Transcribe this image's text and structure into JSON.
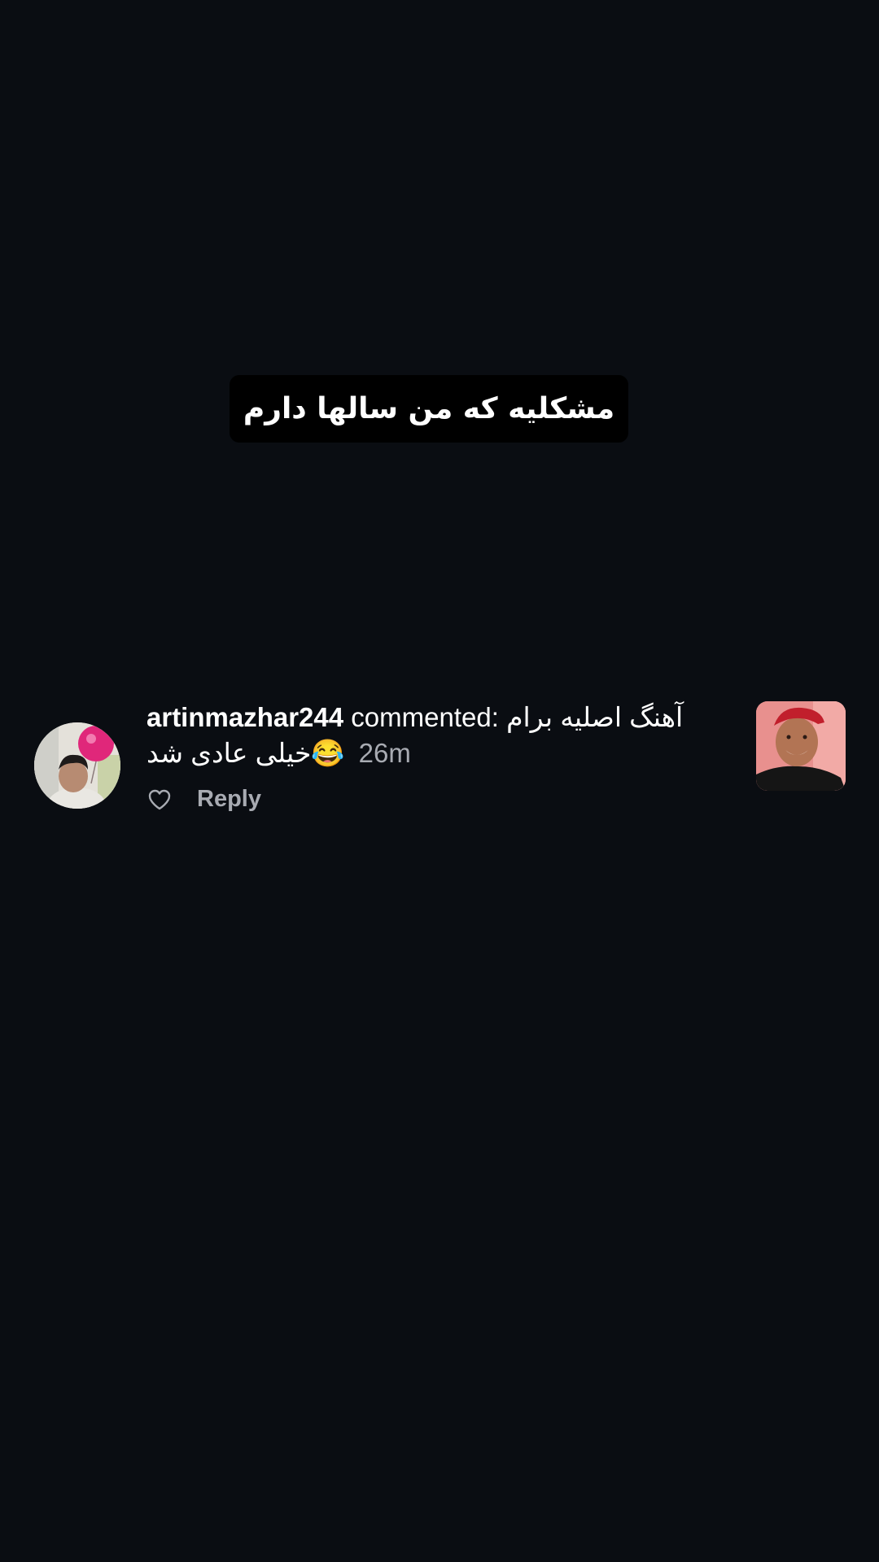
{
  "caption": {
    "text": "مشکلیه که من سالها دارم"
  },
  "comment": {
    "username": "artinmazhar244",
    "verb": "commented:",
    "text_line1": "آهنگ اصلیه برام",
    "text_line2": "خیلی عادی شد",
    "emoji": "😂",
    "time": "26m",
    "reply_label": "Reply"
  },
  "icons": {
    "like": "heart-outline-icon"
  }
}
